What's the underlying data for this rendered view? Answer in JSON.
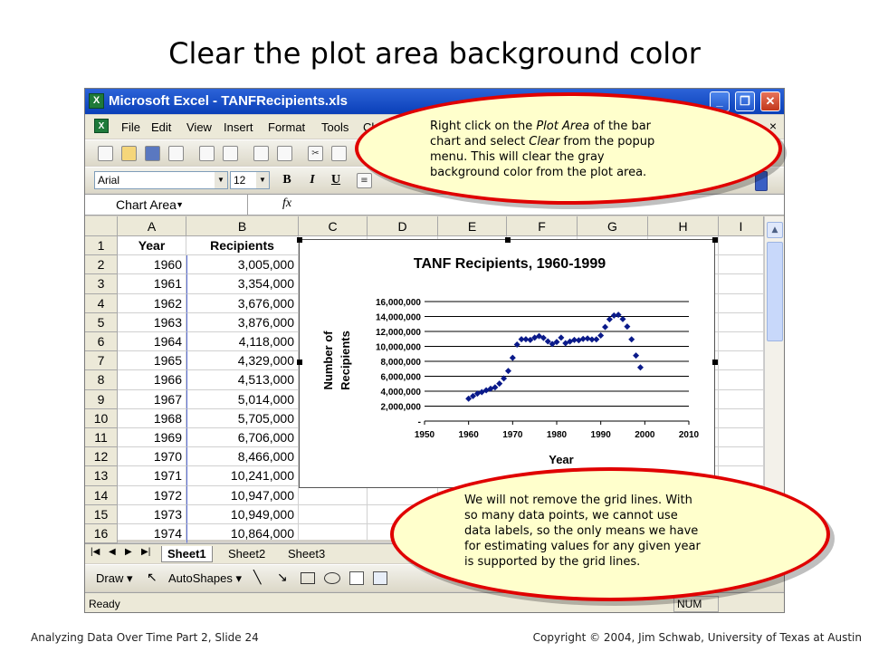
{
  "slide": {
    "title": "Clear the plot area background color",
    "footer_left": "Analyzing Data Over Time Part 2, Slide 24",
    "footer_right": "Copyright © 2004, Jim Schwab, University of Texas at Austin"
  },
  "window": {
    "title": "Microsoft Excel - TANFRecipients.xls",
    "icon": "excel-icon",
    "buttons": [
      "_",
      "❐",
      "✕"
    ]
  },
  "menu": {
    "items": [
      "File",
      "Edit",
      "View",
      "Insert",
      "Format",
      "Tools",
      "Ch"
    ],
    "close": "×"
  },
  "toolbar": {
    "font": "Arial",
    "size": "12",
    "bold": "B",
    "italic": "I",
    "underline": "U"
  },
  "formula_bar": {
    "name_box": "Chart Area",
    "fx": "fx"
  },
  "sheet": {
    "columns": [
      "A",
      "B",
      "C",
      "D",
      "E",
      "F",
      "G",
      "H",
      "I"
    ],
    "rows": [
      "1",
      "2",
      "3",
      "4",
      "5",
      "6",
      "7",
      "8",
      "9",
      "10",
      "11",
      "12",
      "13",
      "14",
      "15",
      "16"
    ],
    "header": [
      "Year",
      "Recipients"
    ],
    "data": [
      [
        "1960",
        "3,005,000"
      ],
      [
        "1961",
        "3,354,000"
      ],
      [
        "1962",
        "3,676,000"
      ],
      [
        "1963",
        "3,876,000"
      ],
      [
        "1964",
        "4,118,000"
      ],
      [
        "1965",
        "4,329,000"
      ],
      [
        "1966",
        "4,513,000"
      ],
      [
        "1967",
        "5,014,000"
      ],
      [
        "1968",
        "5,705,000"
      ],
      [
        "1969",
        "6,706,000"
      ],
      [
        "1970",
        "8,466,000"
      ],
      [
        "1971",
        "10,241,000"
      ],
      [
        "1972",
        "10,947,000"
      ],
      [
        "1973",
        "10,949,000"
      ],
      [
        "1974",
        "10,864,000"
      ]
    ]
  },
  "tabs": {
    "nav": [
      "|◀",
      "◀",
      "▶",
      "▶|"
    ],
    "sheets": [
      "Sheet1",
      "Sheet2",
      "Sheet3"
    ],
    "active": "Sheet1"
  },
  "drawing": {
    "draw": "Draw ▾",
    "autoshapes": "AutoShapes ▾"
  },
  "status": {
    "ready": "Ready",
    "num": "NUM"
  },
  "callouts": {
    "top": {
      "line1_a": "Right click on the ",
      "line1_em": "Plot Area",
      "line1_b": " of the bar",
      "line2_a": "chart and select ",
      "line2_em": "Clear",
      "line2_b": " from the popup",
      "line3": "menu. This will clear the gray",
      "line4": "background color from the plot area."
    },
    "bottom": {
      "lines": [
        "We will not remove the grid lines. With",
        "so many data points, we cannot use",
        "data labels, so the only means we have",
        "for estimating values for any given year",
        "is supported by the grid lines."
      ]
    }
  },
  "chart_data": {
    "type": "scatter",
    "title": "TANF Recipients, 1960-1999",
    "xlabel": "Year",
    "ylabel": "Number of Recipients",
    "xlim": [
      1950,
      2010
    ],
    "ylim": [
      0,
      16000000
    ],
    "xticks": [
      "1950",
      "1960",
      "1970",
      "1980",
      "1990",
      "2000",
      "2010"
    ],
    "yticks": [
      "-",
      "2,000,000",
      "4,000,000",
      "6,000,000",
      "8,000,000",
      "10,000,000",
      "12,000,000",
      "14,000,000",
      "16,000,000"
    ],
    "grid": true,
    "marker_color": "#0a1a8a",
    "x": [
      1960,
      1961,
      1962,
      1963,
      1964,
      1965,
      1966,
      1967,
      1968,
      1969,
      1970,
      1971,
      1972,
      1973,
      1974,
      1975,
      1976,
      1977,
      1978,
      1979,
      1980,
      1981,
      1982,
      1983,
      1984,
      1985,
      1986,
      1987,
      1988,
      1989,
      1990,
      1991,
      1992,
      1993,
      1994,
      1995,
      1996,
      1997,
      1998,
      1999
    ],
    "y": [
      3005000,
      3354000,
      3676000,
      3876000,
      4118000,
      4329000,
      4513000,
      5014000,
      5705000,
      6706000,
      8466000,
      10241000,
      10947000,
      10949000,
      10864000,
      11165000,
      11386000,
      11130000,
      10672000,
      10318000,
      10597000,
      11160000,
      10431000,
      10659000,
      10866000,
      10813000,
      10997000,
      11065000,
      10920000,
      10934000,
      11460000,
      12595000,
      13625000,
      14143000,
      14226000,
      13652000,
      12648000,
      10936000,
      8770000,
      7188000
    ]
  }
}
